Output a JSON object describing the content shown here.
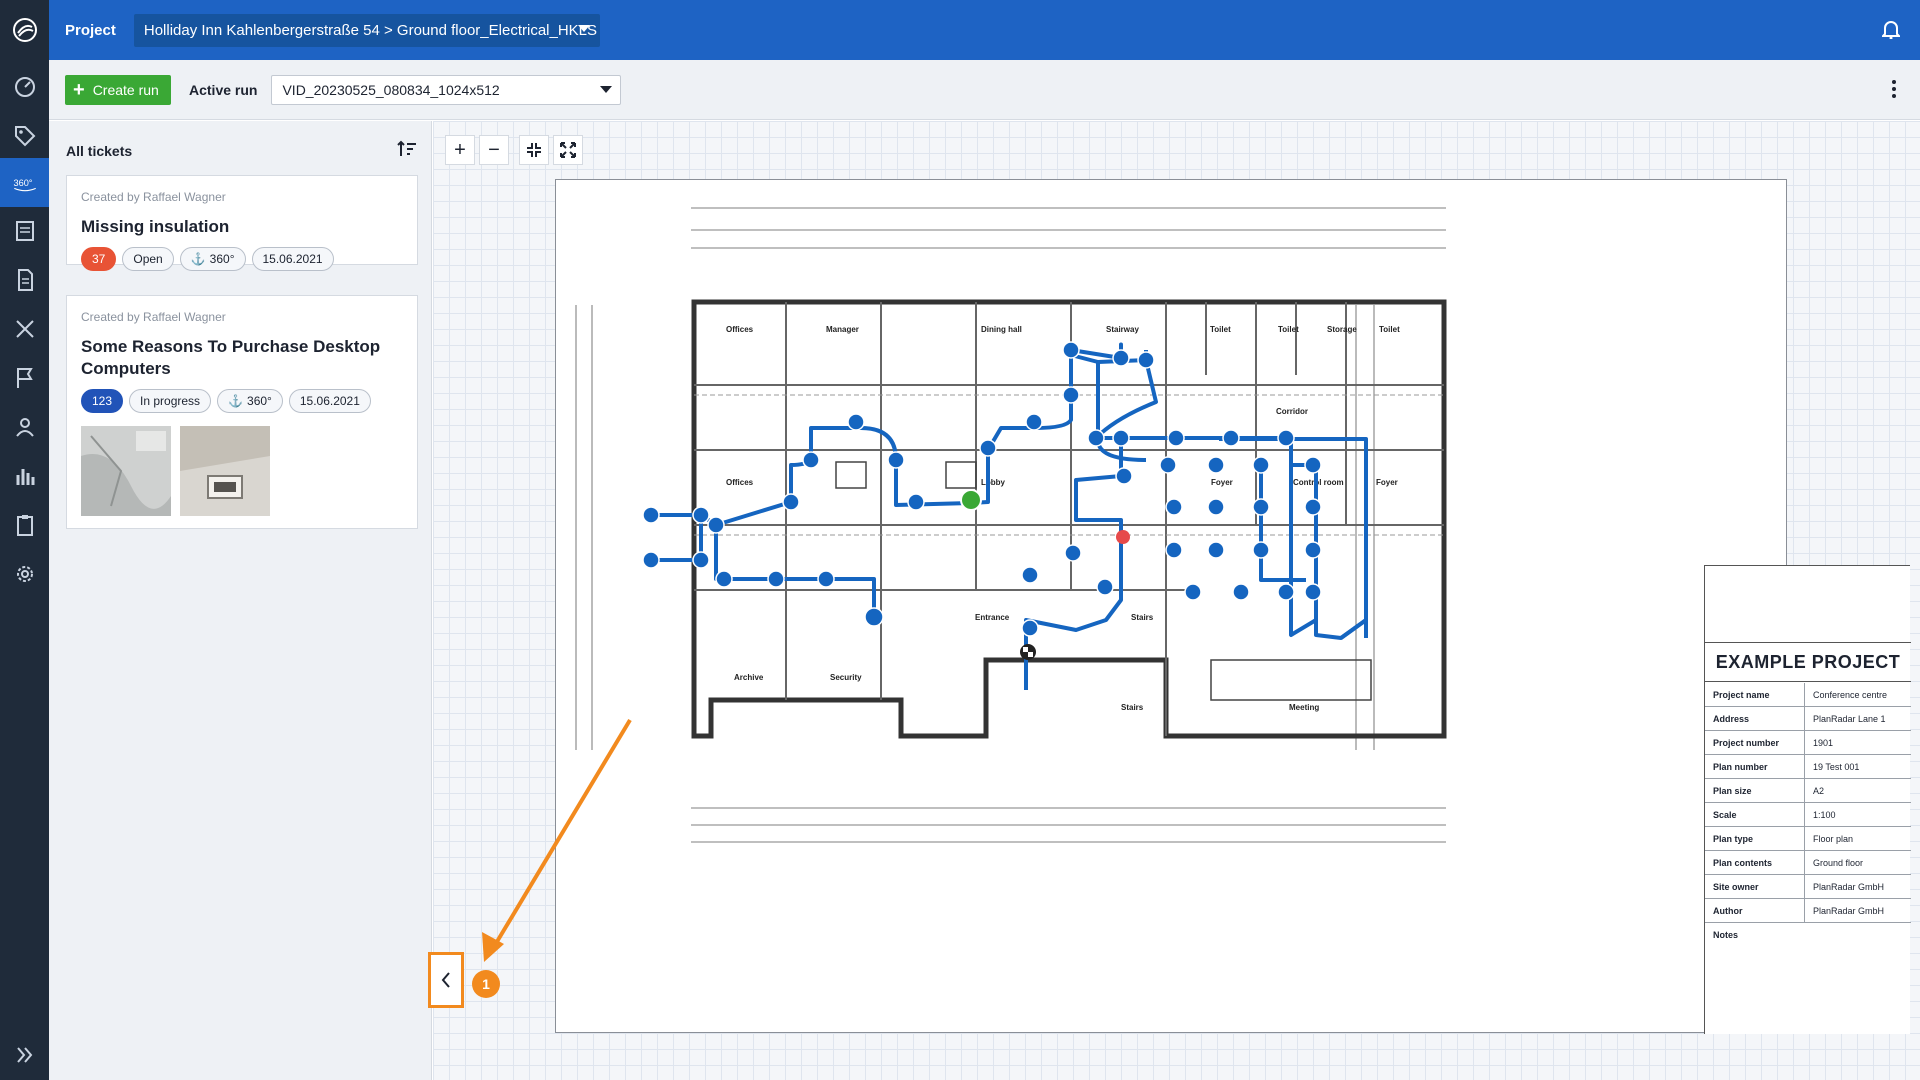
{
  "topbar": {
    "project_label": "Project",
    "project_path": "Holliday Inn Kahlenbergerstraße 54 > Ground floor_Electrical_HKLS"
  },
  "toolbar": {
    "create_run_label": "Create run",
    "active_run_label": "Active run",
    "active_run_value": "VID_20230525_080834_1024x512"
  },
  "panel": {
    "header": "All tickets",
    "tickets": [
      {
        "creator": "Created by Raffael Wagner",
        "title": "Missing insulation",
        "number": "37",
        "status": "Open",
        "type": "360°",
        "date": "15.06.2021"
      },
      {
        "creator": "Created by Raffael Wagner",
        "title": "Some Reasons To Purchase Desktop Computers",
        "number": "123",
        "status": "In progress",
        "type": "360°",
        "date": "15.06.2021"
      }
    ]
  },
  "plan": {
    "rooms": [
      "Offices",
      "Manager",
      "Dining hall",
      "Stairway",
      "Toilet",
      "Toilet",
      "Storage",
      "Toilet",
      "Corridor",
      "Offices",
      "Lobby",
      "Foyer",
      "Control room",
      "Foyer",
      "Entrance",
      "Stairs",
      "Archive",
      "Security",
      "Stairs",
      "Meeting"
    ],
    "title_block": {
      "heading": "EXAMPLE PROJECT",
      "rows": [
        {
          "k": "Project name",
          "v": "Conference centre"
        },
        {
          "k": "Address",
          "v": "PlanRadar Lane 1"
        },
        {
          "k": "Project number",
          "v": "1901"
        },
        {
          "k": "Plan number",
          "v": "19 Test 001"
        },
        {
          "k": "Plan size",
          "v": "A2"
        },
        {
          "k": "Scale",
          "v": "1:100"
        },
        {
          "k": "Plan type",
          "v": "Floor plan"
        },
        {
          "k": "Plan contents",
          "v": "Ground floor"
        },
        {
          "k": "Site owner",
          "v": "PlanRadar GmbH"
        },
        {
          "k": "Author",
          "v": "PlanRadar GmbH"
        },
        {
          "k": "Notes",
          "v": ""
        }
      ]
    }
  },
  "annotation": {
    "step": "1"
  },
  "colors": {
    "brand": "#1e63c4",
    "rail": "#1f2b3a",
    "create": "#3aa835",
    "path": "#1565c0",
    "callout": "#f28a1e"
  }
}
